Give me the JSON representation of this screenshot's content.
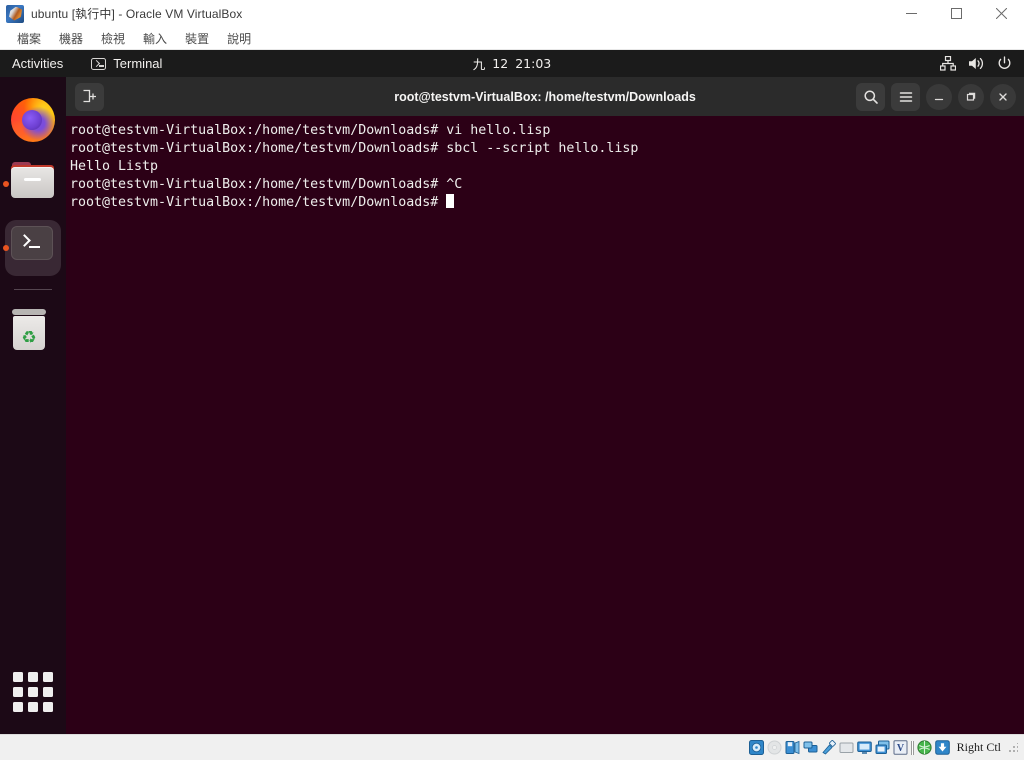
{
  "host_window": {
    "title": "ubuntu [執行中] - Oracle VM VirtualBox",
    "app_icon": "virtualbox-icon",
    "controls": {
      "minimize": "minimize-icon",
      "maximize": "maximize-icon",
      "close": "close-icon"
    },
    "menu": [
      {
        "label": "檔案"
      },
      {
        "label": "機器"
      },
      {
        "label": "檢視"
      },
      {
        "label": "輸入"
      },
      {
        "label": "裝置"
      },
      {
        "label": "說明"
      }
    ]
  },
  "gnome_topbar": {
    "activities": "Activities",
    "app_icon": "terminal-icon",
    "app_name": "Terminal",
    "clock": {
      "month": "九",
      "day": "12",
      "time": "21:03"
    },
    "status_icons": [
      {
        "name": "network-icon"
      },
      {
        "name": "volume-icon"
      },
      {
        "name": "power-icon"
      }
    ]
  },
  "dock": {
    "items": [
      {
        "name": "firefox",
        "label": "Firefox",
        "icon": "firefox-icon",
        "running": false,
        "active": false
      },
      {
        "name": "files",
        "label": "Files",
        "icon": "folder-icon",
        "running": true,
        "active": false
      },
      {
        "name": "terminal",
        "label": "Terminal",
        "icon": "terminal-icon",
        "running": true,
        "active": true
      },
      {
        "name": "trash",
        "label": "Trash",
        "icon": "trash-icon",
        "running": false,
        "active": false
      }
    ],
    "show_apps_label": "Show Applications"
  },
  "terminal_window": {
    "title": "root@testvm-VirtualBox: /home/testvm/Downloads",
    "new_tab_icon": "new-tab-icon",
    "search_icon": "search-icon",
    "menu_icon": "hamburger-menu-icon",
    "minimize_icon": "minimize-icon",
    "maximize_icon": "restore-icon",
    "close_icon": "close-icon",
    "prompt": "root@testvm-VirtualBox:/home/testvm/Downloads# ",
    "lines": [
      {
        "type": "command",
        "prompt": "root@testvm-VirtualBox:/home/testvm/Downloads# ",
        "text": "vi hello.lisp"
      },
      {
        "type": "command",
        "prompt": "root@testvm-VirtualBox:/home/testvm/Downloads# ",
        "text": "sbcl --script hello.lisp"
      },
      {
        "type": "output",
        "prompt": "",
        "text": "Hello Listp"
      },
      {
        "type": "command",
        "prompt": "root@testvm-VirtualBox:/home/testvm/Downloads# ",
        "text": "^C"
      },
      {
        "type": "prompt",
        "prompt": "root@testvm-VirtualBox:/home/testvm/Downloads# ",
        "text": ""
      }
    ]
  },
  "status_bar": {
    "icons": [
      {
        "name": "hard-disk-icon",
        "enabled": true
      },
      {
        "name": "optical-disk-icon",
        "enabled": false
      },
      {
        "name": "floppy-disk-icon",
        "enabled": true
      },
      {
        "name": "network-icon",
        "enabled": true
      },
      {
        "name": "usb-icon",
        "enabled": true
      },
      {
        "name": "shared-folders-icon",
        "enabled": true
      },
      {
        "name": "display-icon",
        "enabled": true
      },
      {
        "name": "video-capture-icon",
        "enabled": true
      },
      {
        "name": "virtualbox-logo-icon",
        "enabled": true
      },
      {
        "name": "mouse-integration-icon",
        "enabled": true
      },
      {
        "name": "host-key-icon",
        "enabled": true
      }
    ],
    "host_key": "Right Ctl"
  },
  "colors": {
    "terminal_bg": "#2c0016",
    "terminal_header": "#2b2b2b",
    "gnome_topbar": "#1b1b1b",
    "dock_bg": "#1a0a16",
    "accent_orange": "#e95420",
    "terminal_text": "#eeeeec"
  }
}
